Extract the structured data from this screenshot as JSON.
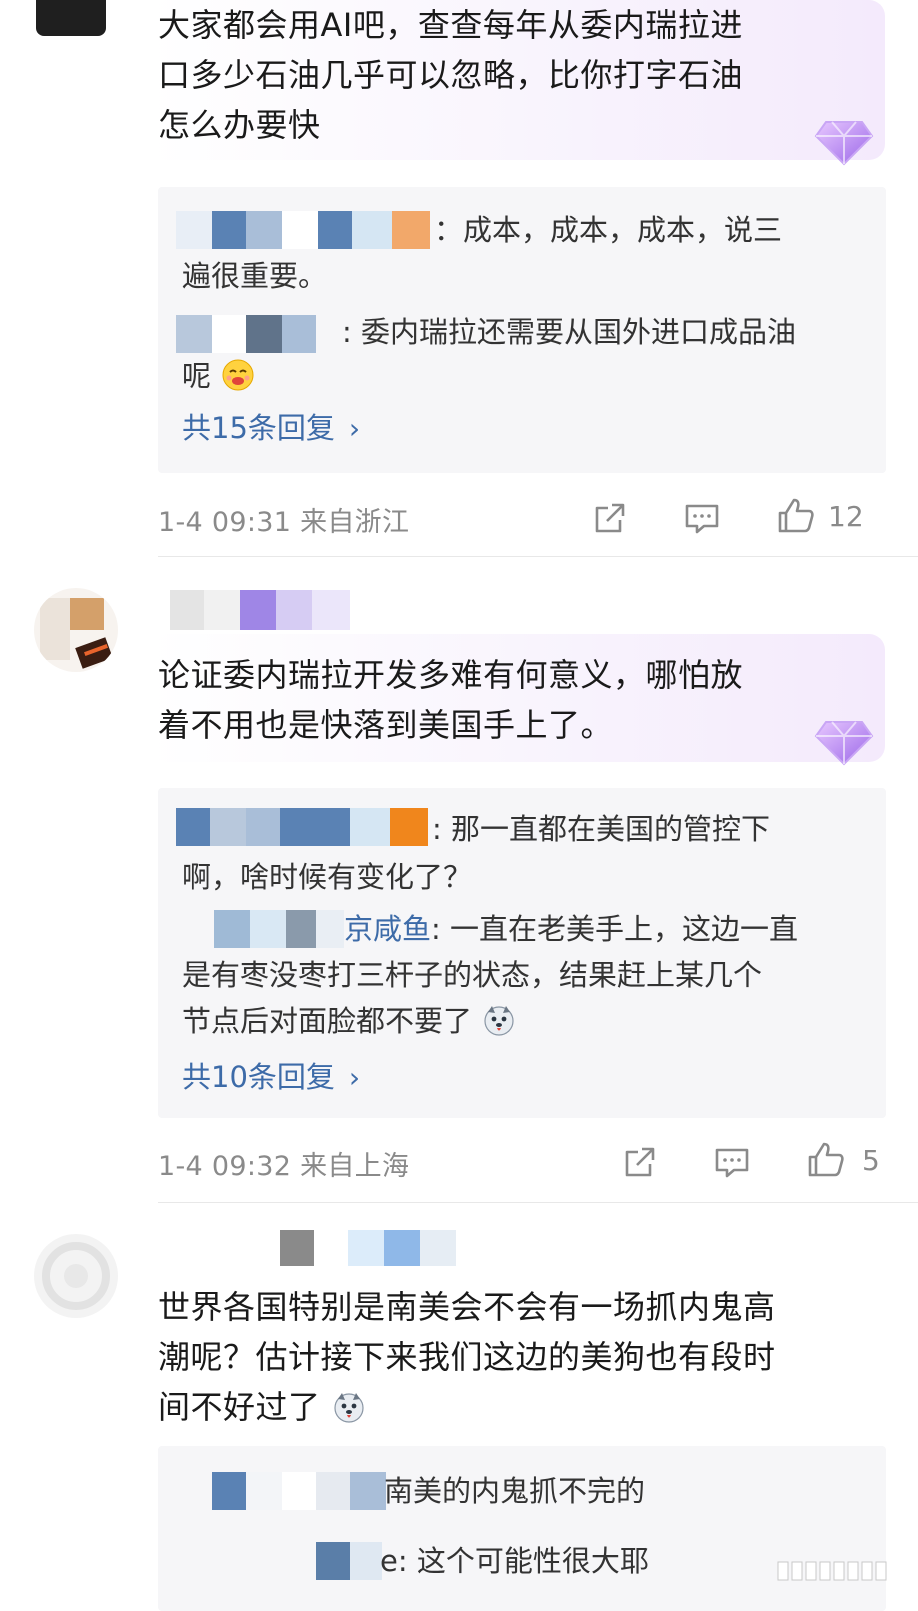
{
  "comments": [
    {
      "body_lines": [
        "大家都会用AI吧，查查每年从委内瑞拉进",
        "口多少石油几乎可以忽略，比你打字石油",
        "怎么办要快"
      ],
      "replies": [
        {
          "name": "",
          "text_lines": [
            "：成本，成本，成本，说三",
            "遍很重要。"
          ]
        },
        {
          "name": "",
          "text_lines": [
            ": 委内瑞拉还需要从国外进口成品油",
            "呢"
          ]
        }
      ],
      "more_replies": "共15条回复",
      "meta": "1-4 09:31 来自浙江",
      "likes": "12"
    },
    {
      "body_lines": [
        "论证委内瑞拉开发多难有何意义，哪怕放",
        "着不用也是快落到美国手上了。"
      ],
      "replies": [
        {
          "name": "",
          "text_lines": [
            ": 那一直都在美国的管控下",
            "啊，啥时候有变化了？"
          ]
        },
        {
          "name": "京咸鱼",
          "text_lines": [
            ": 一直在老美手上，这边一直",
            "是有枣没枣打三杆子的状态，结果赶上某几个",
            "节点后对面脸都不要了"
          ]
        }
      ],
      "more_replies": "共10条回复",
      "meta": "1-4 09:32 来自上海",
      "likes": "5"
    },
    {
      "body_lines": [
        "世界各国特别是南美会不会有一场抓内鬼高",
        "潮呢？估计接下来我们这边的美狗也有段时",
        "间不好过了"
      ],
      "replies": [
        {
          "name": "",
          "text_lines": [
            "南美的内鬼抓不完的"
          ]
        },
        {
          "name": "",
          "text_lines": [
            "e: 这个可能性很大耶"
          ]
        }
      ]
    }
  ],
  "icons": {
    "share": "share-icon",
    "comment": "comment-icon",
    "like": "thumbs-up-icon",
    "gem": "diamond-badge-icon"
  },
  "colors": {
    "link": "#3d6ba8",
    "meta": "#8a8a8a",
    "reply_bg": "#f6f6f8",
    "badge": "#b58af0"
  }
}
